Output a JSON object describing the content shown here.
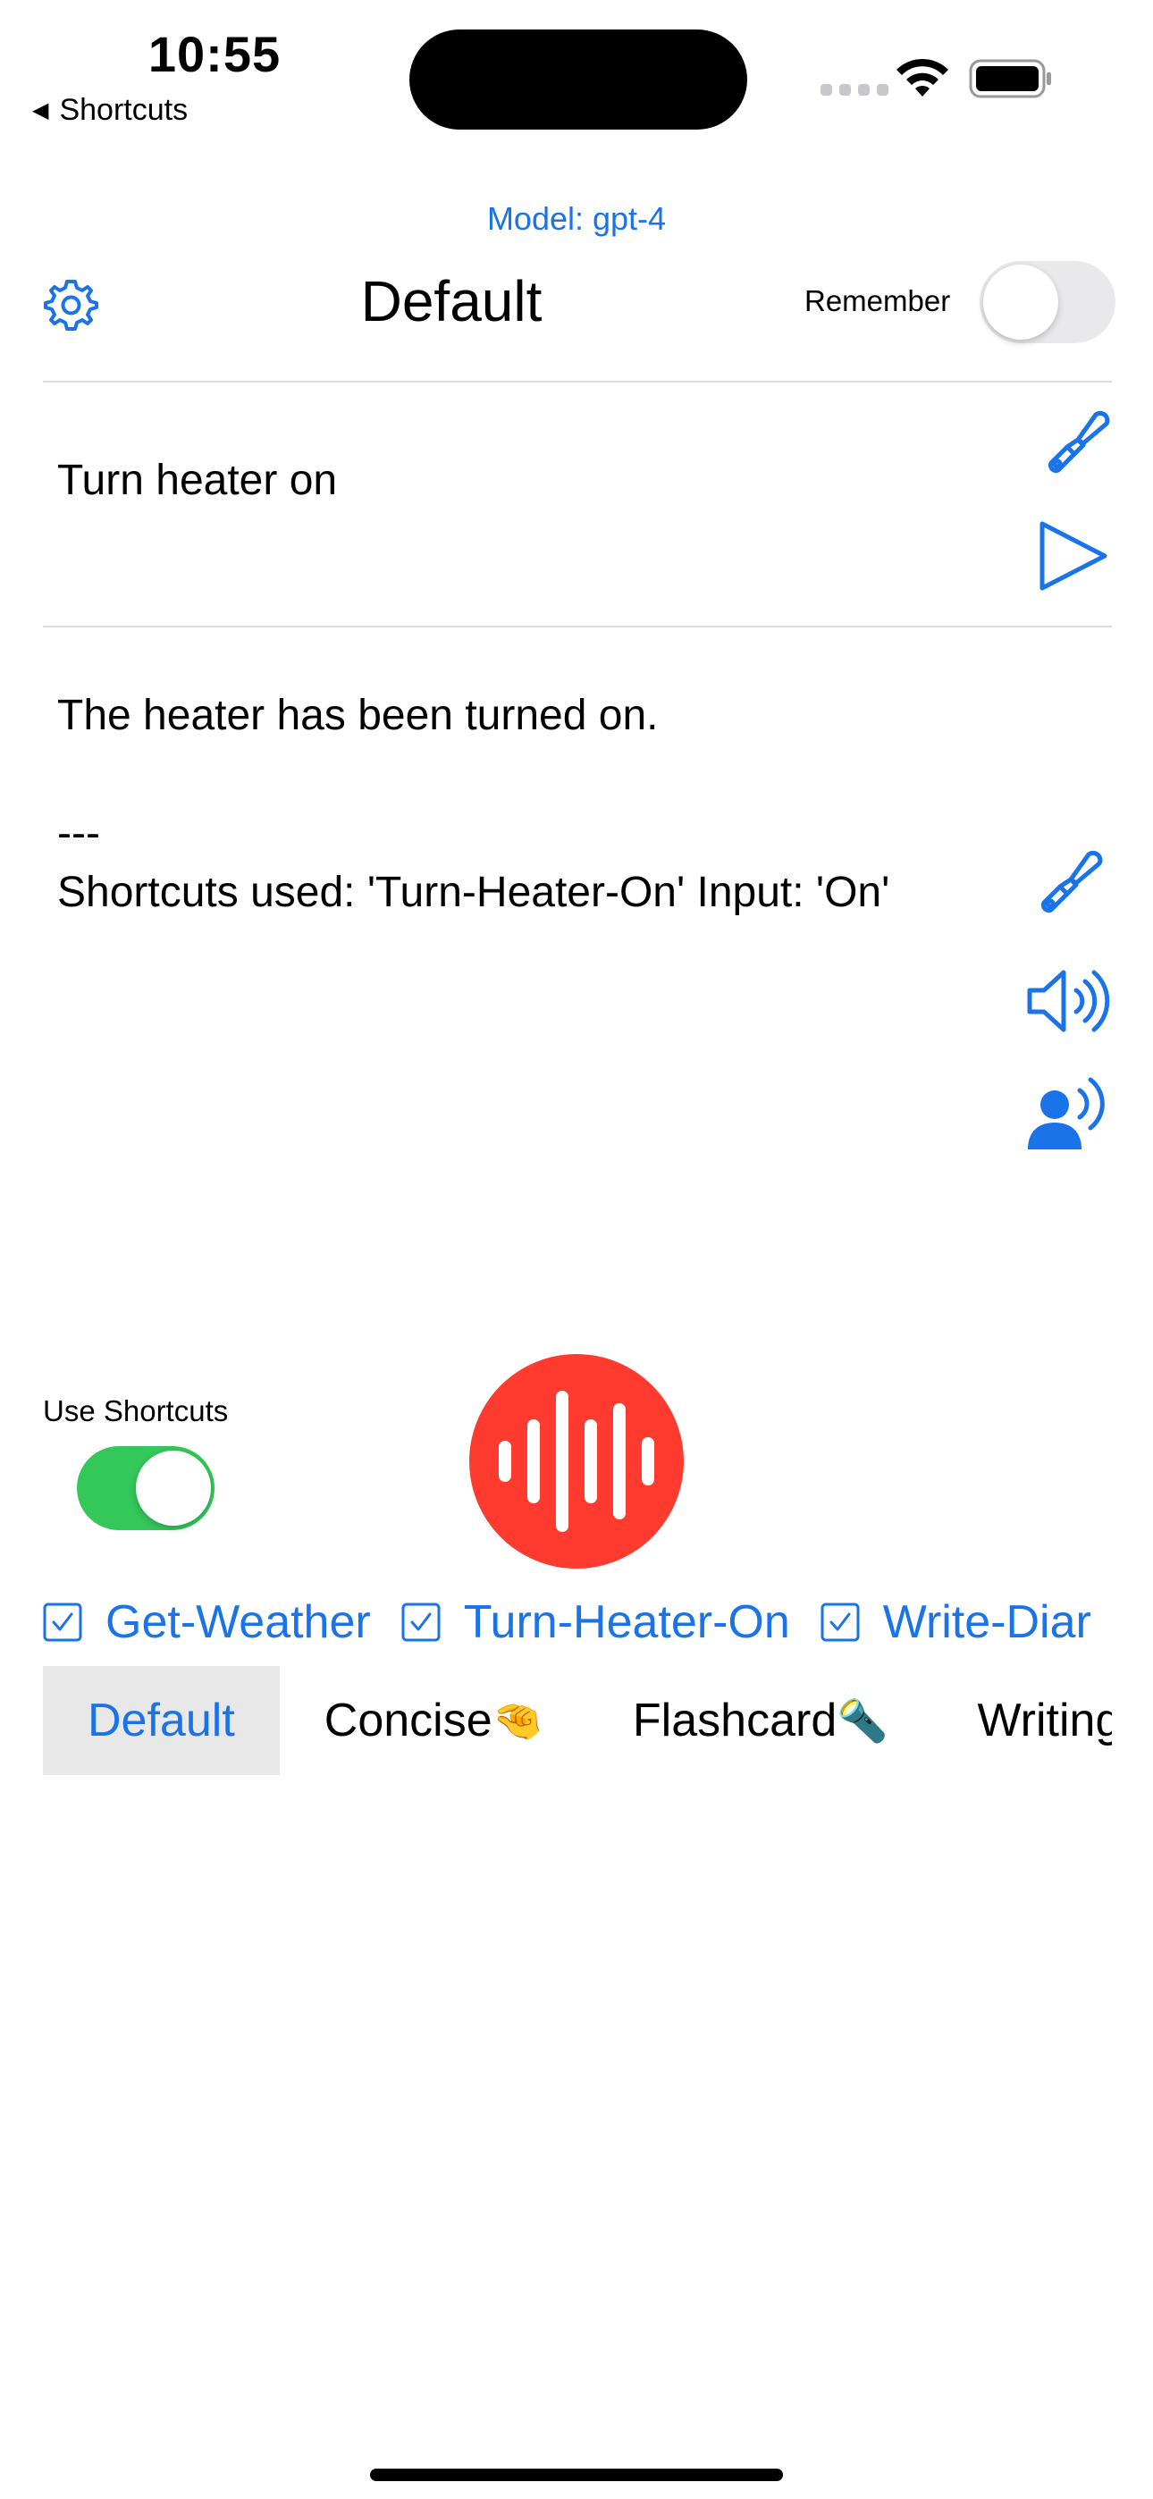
{
  "status_bar": {
    "time": "10:55",
    "back_label": "Shortcuts"
  },
  "header": {
    "model_label": "Model: gpt-4",
    "title": "Default",
    "remember_label": "Remember",
    "remember_on": false
  },
  "prompt": {
    "text": "Turn heater on"
  },
  "response": {
    "text": "The heater has been turned on.\n\n---\nShortcuts used: 'Turn-Heater-On' Input: 'On'"
  },
  "controls": {
    "use_shortcuts_label": "Use Shortcuts",
    "use_shortcuts_on": true
  },
  "shortcuts": [
    {
      "label": "Get-Weather",
      "checked": true
    },
    {
      "label": "Turn-Heater-On",
      "checked": true
    },
    {
      "label": "Write-Diar",
      "checked": true
    }
  ],
  "modes": [
    {
      "label": "Default",
      "emoji": "",
      "active": true
    },
    {
      "label": "Concise",
      "emoji": "🤏",
      "active": false
    },
    {
      "label": "Flashcard",
      "emoji": "🔦",
      "active": false
    },
    {
      "label": "Writing",
      "emoji": "",
      "active": false
    }
  ],
  "icons": {
    "settings": "gear-icon",
    "clear_prompt": "paintbrush-icon",
    "send": "play-icon",
    "clear_response": "paintbrush-icon",
    "speak": "speaker-wave-icon",
    "voice": "person-wave-icon",
    "record": "waveform-icon"
  },
  "colors": {
    "accent": "#1a73e8",
    "record": "#ff3b30",
    "toggle_on": "#34c759"
  }
}
